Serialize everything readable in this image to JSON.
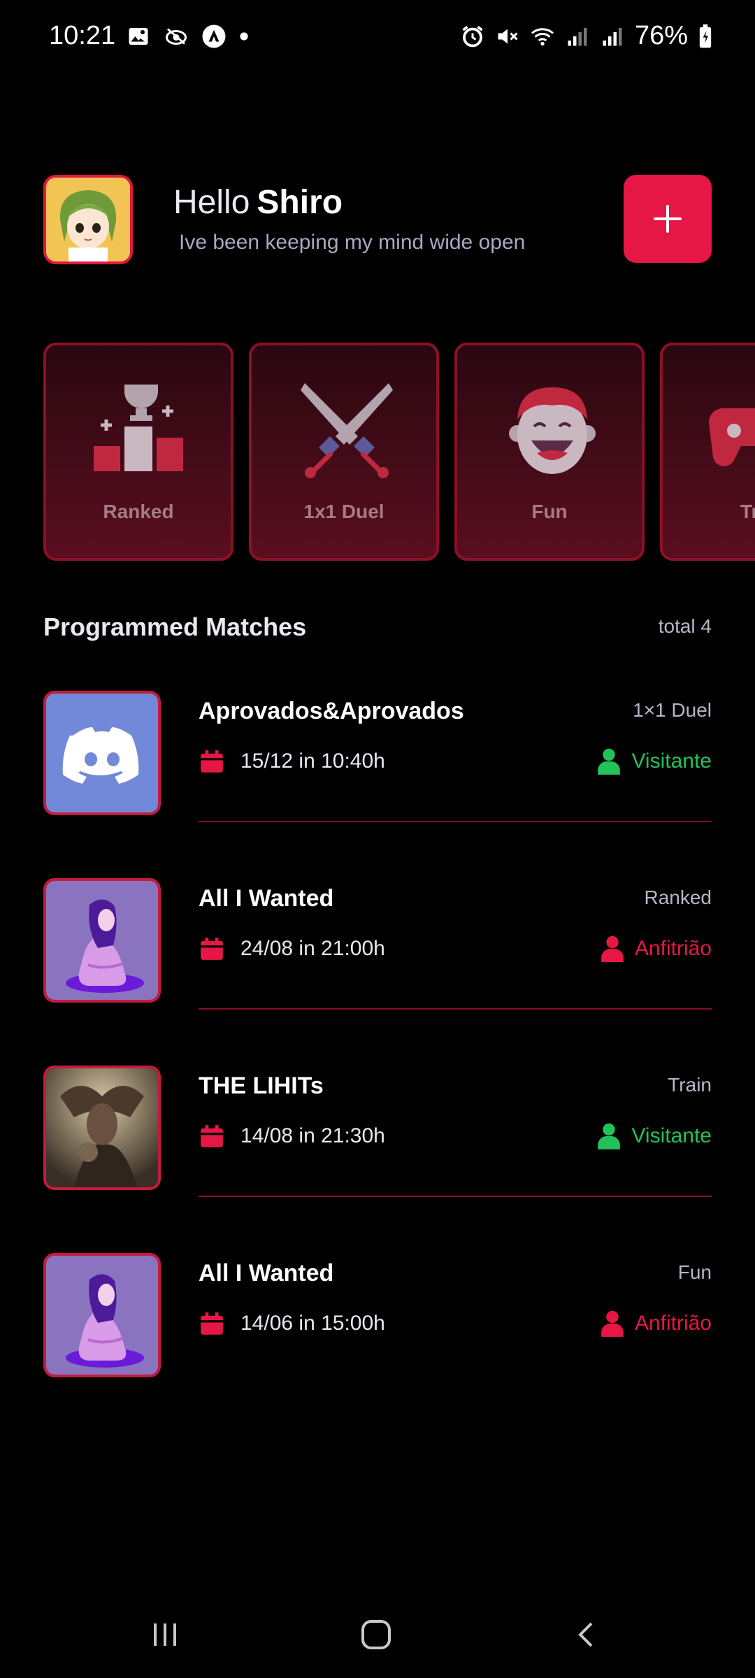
{
  "status_bar": {
    "time": "10:21",
    "battery": "76%",
    "icons_left": [
      "image-icon",
      "tag-icon",
      "alert-a-icon",
      "dot-icon"
    ],
    "icons_right": [
      "alarm-icon",
      "mute-icon",
      "wifi-icon",
      "signal-icon",
      "signal-icon",
      "battery-icon"
    ]
  },
  "header": {
    "hello": "Hello",
    "user_name": "Shiro",
    "subtitle": "Ive been keeping my mind wide open",
    "add_button_icon": "plus-icon"
  },
  "categories": [
    {
      "label": "Ranked",
      "icon": "podium-icon"
    },
    {
      "label": "1x1 Duel",
      "icon": "crossed-swords-icon"
    },
    {
      "label": "Fun",
      "icon": "laughing-face-icon"
    },
    {
      "label": "Tra",
      "icon": "gamepad-icon"
    }
  ],
  "section": {
    "title": "Programmed Matches",
    "total": "total 4"
  },
  "matches": [
    {
      "title": "Aprovados&Aprovados",
      "mode": "1×1 Duel",
      "date": "15/12 in 10:40h",
      "role": "Visitante",
      "role_color": "#22c25a",
      "thumb": "discord-logo"
    },
    {
      "title": "All I Wanted",
      "mode": "Ranked",
      "date": "24/08 in 21:00h",
      "role": "Anfitrião",
      "role_color": "#e61744",
      "thumb": "purple-girl-art"
    },
    {
      "title": "THE LIHITs",
      "mode": "Train",
      "date": "14/08 in 21:30h",
      "role": "Visitante",
      "role_color": "#22c25a",
      "thumb": "dark-fantasy-art"
    },
    {
      "title": "All I Wanted",
      "mode": "Fun",
      "date": "14/06 in 15:00h",
      "role": "Anfitrião",
      "role_color": "#e61744",
      "thumb": "purple-girl-art"
    }
  ],
  "navbar": {
    "items": [
      "recents-icon",
      "home-icon",
      "back-icon"
    ]
  },
  "colors": {
    "accent": "#e61744",
    "visitor": "#22c25a",
    "host": "#e61744",
    "background": "#000000"
  }
}
